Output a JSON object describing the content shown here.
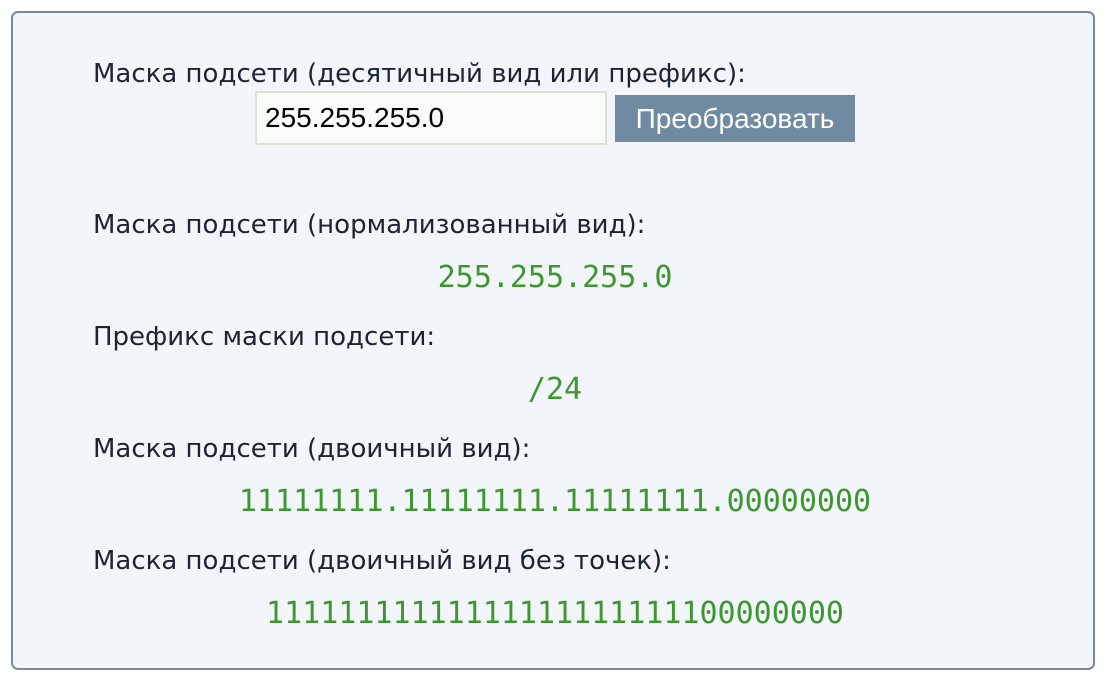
{
  "form": {
    "input_label": "Маска подсети (десятичный вид или префикс):",
    "input_value": "255.255.255.0",
    "button_label": "Преобразовать"
  },
  "results": {
    "normalized_label": "Маска подсети (нормализованный вид):",
    "normalized_value": "255.255.255.0",
    "prefix_label": "Префикс маски подсети:",
    "prefix_value": "/24",
    "binary_label": "Маска подсети (двоичный вид):",
    "binary_value": "11111111.11111111.11111111.00000000",
    "binary_nodots_label": "Маска подсети (двоичный вид без точек):",
    "binary_nodots_value": "11111111111111111111111100000000"
  },
  "colors": {
    "panel_background": "#f2f6fa",
    "panel_border": "#7a8a99",
    "label_text": "#1b2433",
    "result_text": "#3e9630",
    "button_background": "#6f8aa1"
  }
}
